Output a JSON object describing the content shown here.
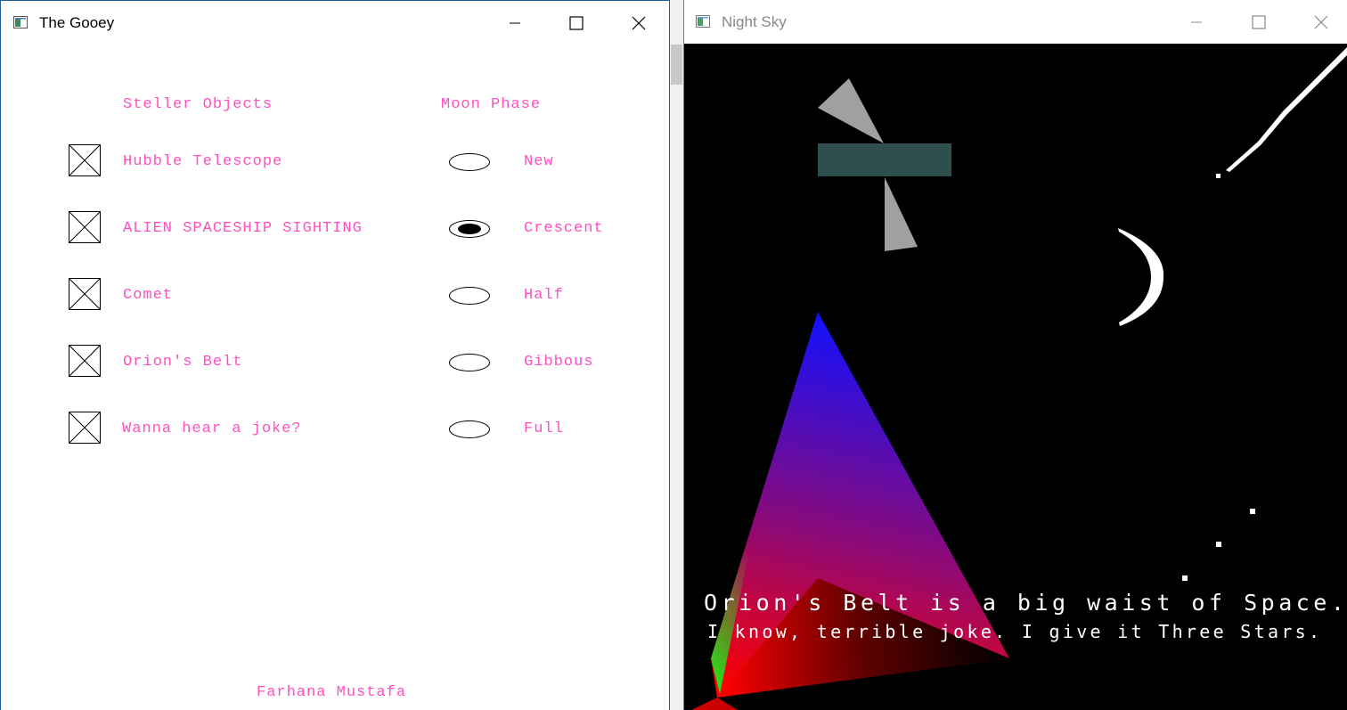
{
  "gooey": {
    "title": "The Gooey",
    "headers": {
      "stellar": "Steller Objects",
      "moon": "Moon Phase"
    },
    "checkboxes": [
      {
        "label": "Hubble Telescope",
        "checked": true
      },
      {
        "label": "ALIEN SPACESHIP SIGHTING",
        "checked": true
      },
      {
        "label": "Comet",
        "checked": true
      },
      {
        "label": "Orion's Belt",
        "checked": true
      },
      {
        "label": "Wanna hear a joke?",
        "checked": true
      }
    ],
    "moon_phases": [
      {
        "label": "New",
        "selected": false
      },
      {
        "label": "Crescent",
        "selected": true
      },
      {
        "label": "Half",
        "selected": false
      },
      {
        "label": "Gibbous",
        "selected": false
      },
      {
        "label": "Full",
        "selected": false
      }
    ],
    "author": "Farhana Mustafa"
  },
  "sky": {
    "title": "Night Sky",
    "joke_line1": "Orion's Belt is a big waist of Space.",
    "joke_line2": "I know, terrible joke. I give it Three Stars."
  },
  "colors": {
    "label_pink": "#ff4fc0",
    "satellite_panel": "#2f4f4f",
    "satellite_wing": "#a0a0a0"
  }
}
